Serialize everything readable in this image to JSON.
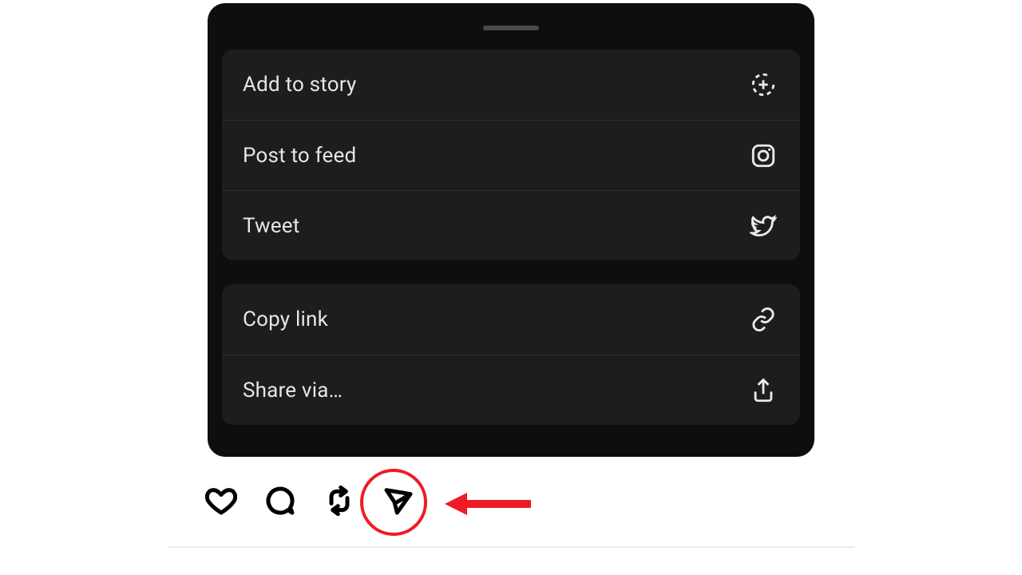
{
  "share_sheet": {
    "group1": [
      {
        "label": "Add to story",
        "icon": "add-story-icon"
      },
      {
        "label": "Post to feed",
        "icon": "instagram-icon"
      },
      {
        "label": "Tweet",
        "icon": "twitter-icon"
      }
    ],
    "group2": [
      {
        "label": "Copy link",
        "icon": "link-icon"
      },
      {
        "label": "Share via…",
        "icon": "share-icon"
      }
    ]
  },
  "action_bar": {
    "like": "like-icon",
    "comment": "comment-icon",
    "repost": "repost-icon",
    "send": "send-icon"
  },
  "annotation": {
    "highlighted_action": "send",
    "circle_color": "#ef1b24",
    "arrow_color": "#ef1b24"
  }
}
